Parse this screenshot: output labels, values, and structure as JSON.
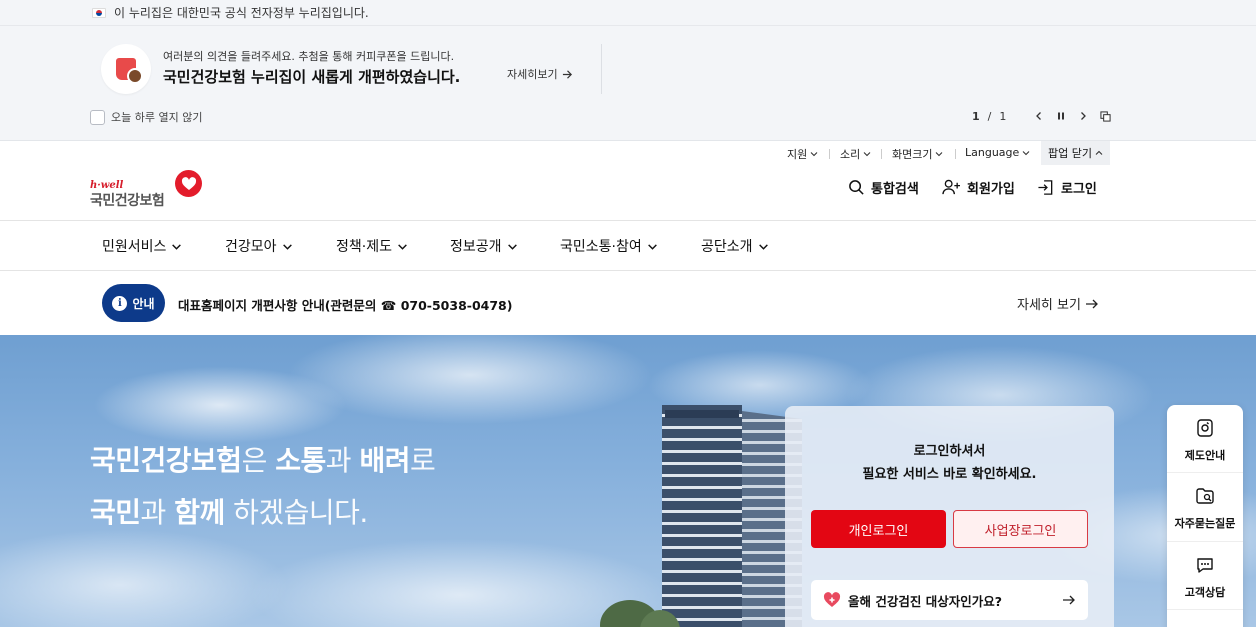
{
  "gov_bar": {
    "text": "이 누리집은 대한민국 공식 전자정부 누리집입니다."
  },
  "popup": {
    "subtitle": "여러분의 의견을 들려주세요. 추첨을 통해 커피쿠폰을 드립니다.",
    "title": "국민건강보험 누리집이 새롭게 개편하였습니다.",
    "more_label": "자세히보기",
    "dont_show_label": "오늘 하루 열지 않기",
    "pager_current": "1",
    "pager_sep": "/",
    "pager_total": "1"
  },
  "util": {
    "support": "지원",
    "sound": "소리",
    "screen_size": "화면크기",
    "language": "Language",
    "close_popup": "팝업 닫기"
  },
  "logo": {
    "hwell": "h·well",
    "name": "국민건강보험"
  },
  "header": {
    "search": "통합검색",
    "signup": "회원가입",
    "login": "로그인"
  },
  "gnb": {
    "items": [
      "민원서비스",
      "건강모아",
      "정책·제도",
      "정보공개",
      "국민소통·참여",
      "공단소개"
    ]
  },
  "notice": {
    "badge": "안내",
    "text": "대표홈페이지 개편사항 안내(관련문의 ☎ 070-5038-0478)",
    "more": "자세히 보기"
  },
  "hero": {
    "line1_bold1": "국민건강보험",
    "line1_t1": "은 ",
    "line1_bold2": "소통",
    "line1_t2": "과 ",
    "line1_bold3": "배려",
    "line1_t3": "로",
    "line2_bold1": "국민",
    "line2_t1": "과 ",
    "line2_bold2": "함께",
    "line2_t2": " 하겠습니다."
  },
  "login_card": {
    "msg_line1": "로그인하셔서",
    "msg_line2": "필요한 서비스 바로 확인하세요.",
    "personal_login": "개인로그인",
    "business_login": "사업장로그인",
    "checkup_question": "올해 건강검진 대상자인가요?"
  },
  "quick_menu": {
    "items": [
      "제도안내",
      "자주묻는질문",
      "고객상담"
    ]
  },
  "colors": {
    "brand_red": "#e30613",
    "brand_navy": "#0d3a8a"
  }
}
